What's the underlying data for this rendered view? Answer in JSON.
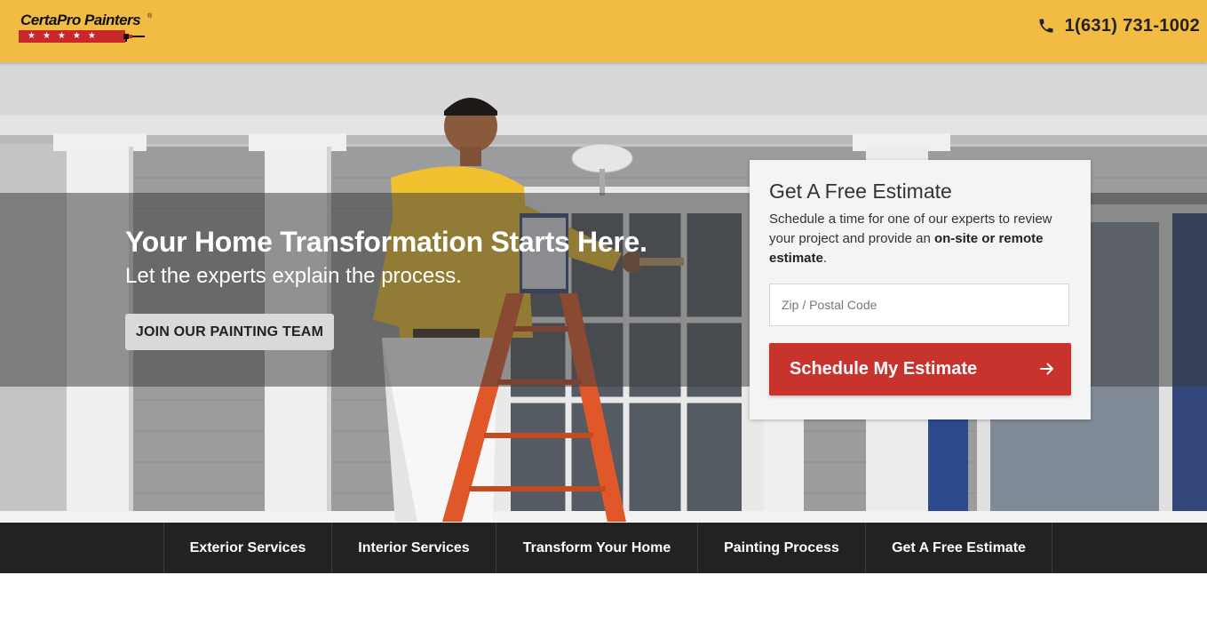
{
  "header": {
    "logo_text": "CertaPro Painters",
    "logo_reg": "®",
    "logo_stars": "★★★★★",
    "phone": "1(631) 731-1002"
  },
  "hero": {
    "title": "Your Home Transformation Starts Here.",
    "subtitle": "Let the experts explain the process.",
    "join_button": "JOIN OUR PAINTING TEAM"
  },
  "estimate": {
    "title": "Get A Free Estimate",
    "desc_plain": "Schedule a time for one of our experts to review your project and provide an ",
    "desc_bold": "on-site or remote estimate",
    "desc_end": ".",
    "zip_placeholder": "Zip / Postal Code",
    "button": "Schedule My Estimate"
  },
  "nav": {
    "items": [
      {
        "label": "Exterior Services"
      },
      {
        "label": "Interior Services"
      },
      {
        "label": "Transform Your Home"
      },
      {
        "label": "Painting Process"
      },
      {
        "label": "Get A Free Estimate"
      }
    ]
  },
  "colors": {
    "header_bg": "#f2bb43",
    "accent_red": "#c8332e",
    "nav_bg": "#222222"
  },
  "icons": {
    "phone": "phone-icon",
    "arrow": "arrow-right-icon"
  }
}
